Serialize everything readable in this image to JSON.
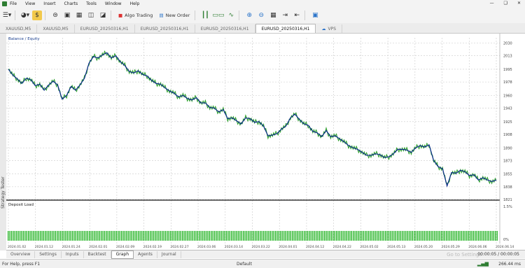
{
  "menu": [
    "File",
    "View",
    "Insert",
    "Charts",
    "Tools",
    "Window",
    "Help"
  ],
  "toolbar": {
    "algo_label": "Algo Trading",
    "new_order_label": "New Order"
  },
  "chart_tabs": [
    "XAUUSD,M5",
    "XAUUSD,M5",
    "EURUSD_20250316,H1",
    "EURUSD_20250316,H1",
    "EURUSD_20250316,H1",
    "EURUSD_20250316,H1",
    "VPS"
  ],
  "active_tab_index": 5,
  "panel_titles": {
    "top": "Balance / Equity",
    "bottom": "Deposit Load"
  },
  "sidebar_label": "Strategy Tester",
  "subtabs": [
    "Overview",
    "Settings",
    "Inputs",
    "Backtest",
    "Graph",
    "Agents",
    "Journal"
  ],
  "active_subtab": "Graph",
  "progress_text": "00:00:05 / 00:00:05",
  "goto_text": "Go to Settings",
  "status": {
    "left": "For Help, press F1",
    "center": "Default",
    "right": "266.44 ms"
  },
  "chart_data": {
    "type": "line",
    "ylim": [
      1822,
      2037
    ],
    "y_ticks": [
      2030,
      2013,
      1995,
      1978,
      1960,
      1943,
      1925,
      1908,
      1890,
      1873,
      1855,
      1838,
      1821
    ],
    "x_ticks": [
      "2024.01.02",
      "2024.01.12",
      "2024.01.24",
      "2024.02.01",
      "2024.02.09",
      "2024.02.19",
      "2024.02.27",
      "2024.03.06",
      "2024.03.14",
      "2024.03.22",
      "2024.04.01",
      "2024.04.12",
      "2024.04.22",
      "2024.05.02",
      "2024.05.13",
      "2024.05.20",
      "2024.05.29",
      "2024.06.06",
      "2024.06.14"
    ],
    "series": [
      {
        "name": "Balance",
        "color": "#0a2a8a"
      },
      {
        "name": "Equity",
        "color": "#2fa02f"
      }
    ],
    "balance": [
      1995,
      1987,
      1982,
      1976,
      1983,
      1981,
      1973,
      1975,
      1967,
      1974,
      1979,
      1974,
      1955,
      1960,
      1972,
      1967,
      1974,
      1983,
      2003,
      2012,
      2010,
      2014,
      2017,
      2010,
      2013,
      2005,
      2000,
      1992,
      1990,
      1993,
      1988,
      1986,
      1980,
      1976,
      1975,
      1970,
      1966,
      1963,
      1958,
      1960,
      1956,
      1954,
      1957,
      1950,
      1950,
      1944,
      1943,
      1938,
      1941,
      1929,
      1930,
      1926,
      1922,
      1930,
      1929,
      1924,
      1925,
      1919,
      1906,
      1907,
      1909,
      1915,
      1919,
      1930,
      1935,
      1928,
      1922,
      1920,
      1912,
      1910,
      1905,
      1913,
      1905,
      1906,
      1902,
      1898,
      1893,
      1890,
      1888,
      1884,
      1880,
      1880,
      1882,
      1881,
      1877,
      1878,
      1882,
      1888,
      1888,
      1887,
      1884,
      1890,
      1893,
      1891,
      1894,
      1873,
      1865,
      1862,
      1839,
      1857,
      1856,
      1860,
      1858,
      1853,
      1854,
      1847,
      1850,
      1847,
      1845,
      1847
    ],
    "deposit_load_bars": 290
  }
}
